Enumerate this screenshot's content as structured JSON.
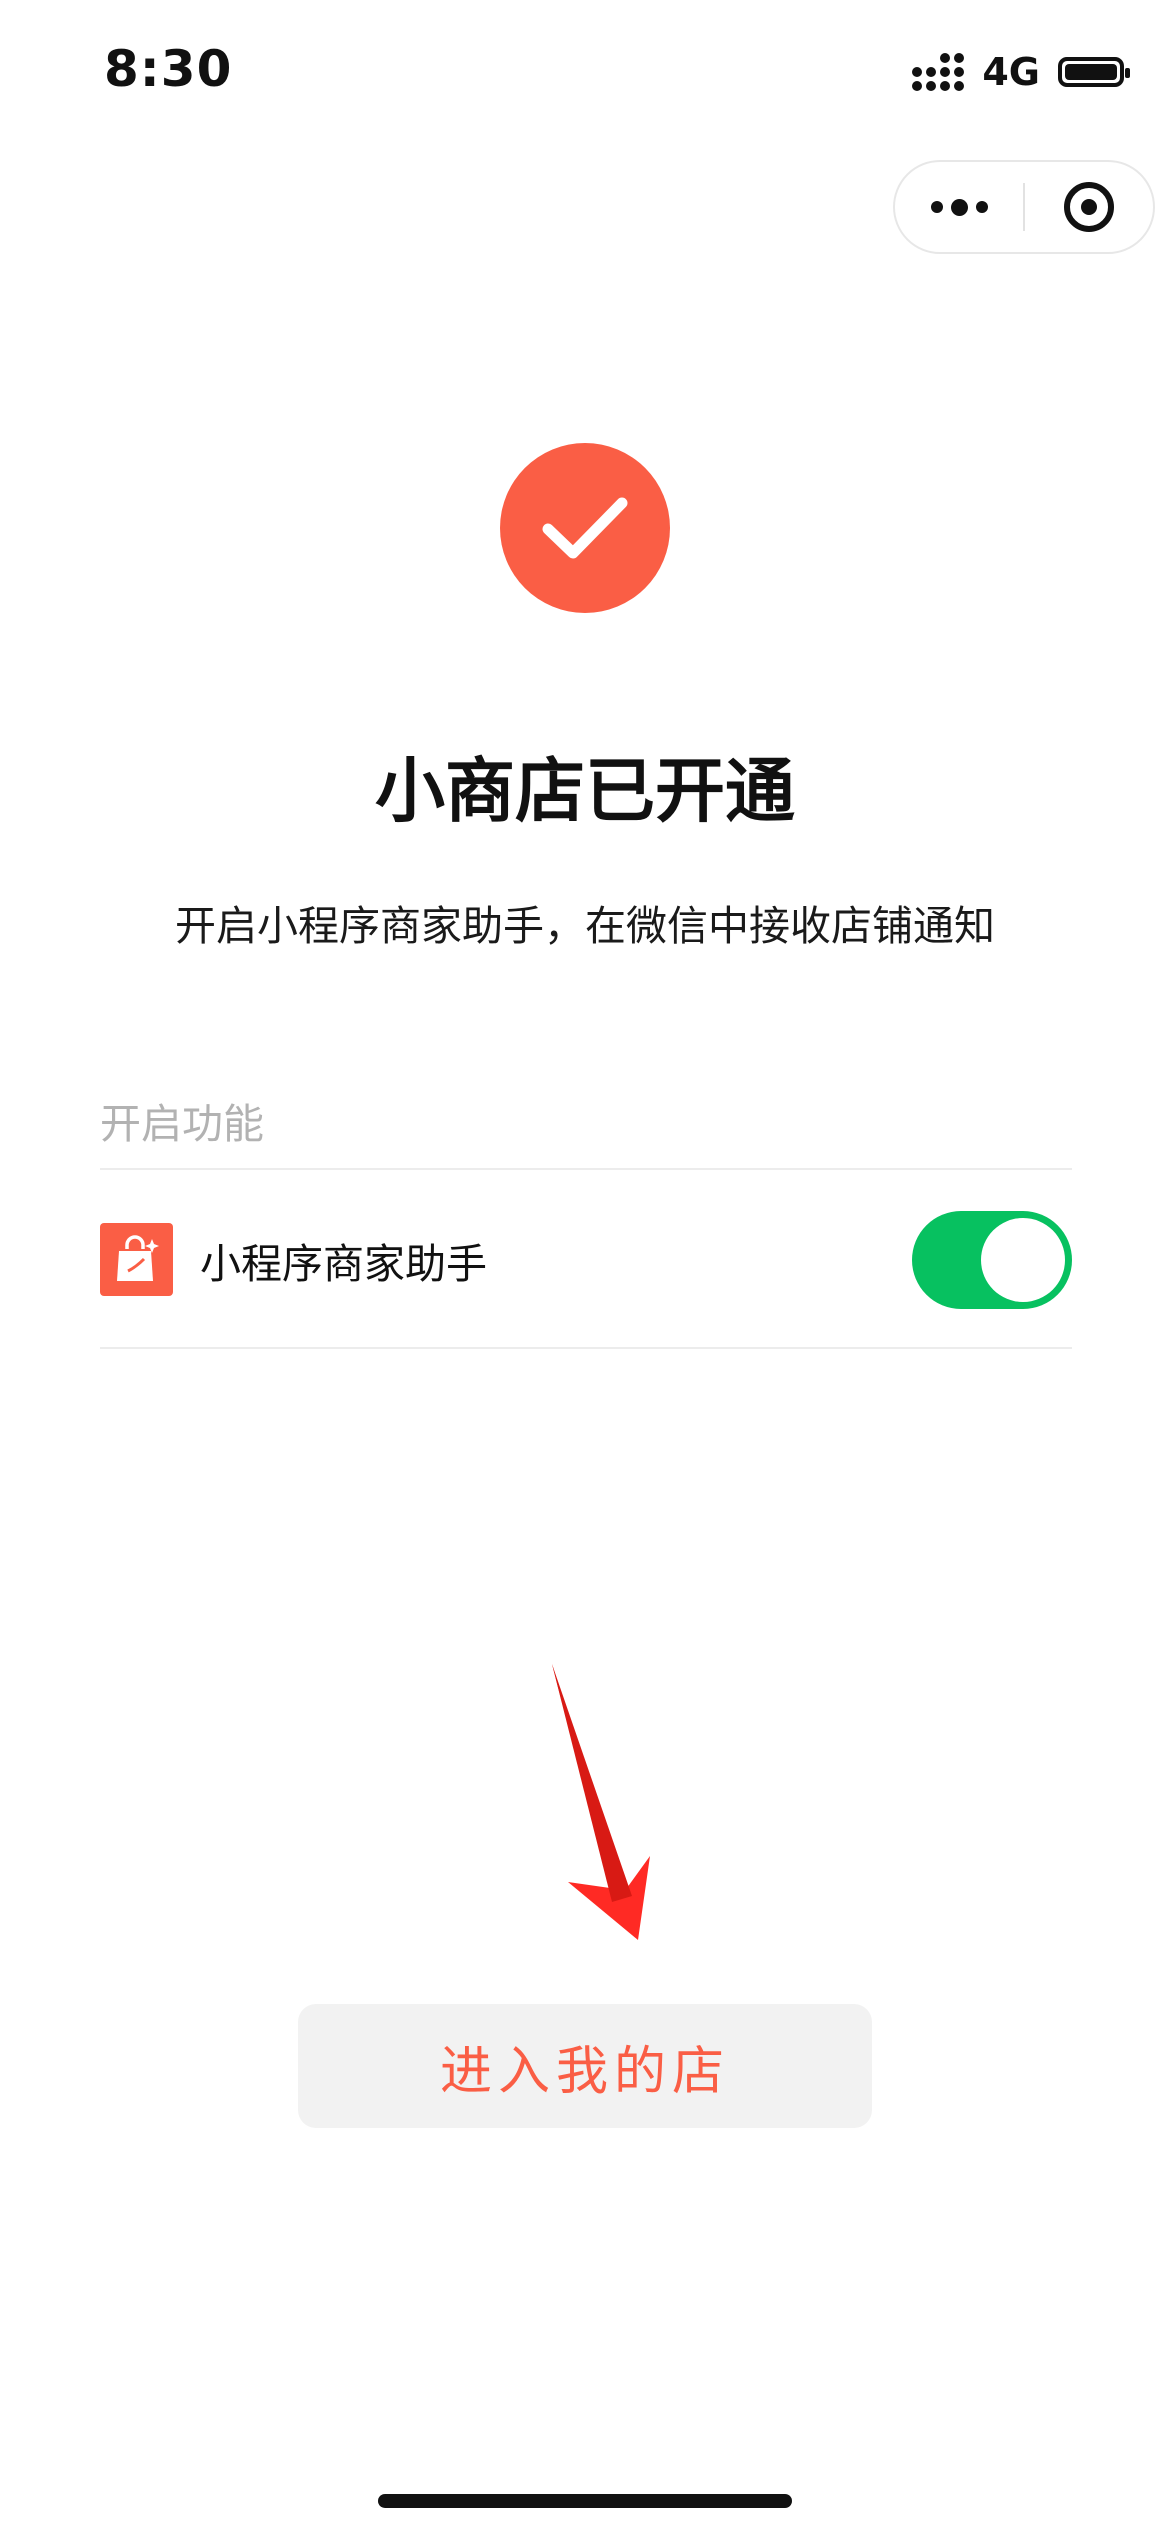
{
  "status_bar": {
    "time": "8:30",
    "network": "4G"
  },
  "capsule": {
    "more_icon": "more-dots-icon",
    "close_icon": "target-circle-icon"
  },
  "result": {
    "icon": "check-icon",
    "title": "小商店已开通",
    "subtitle": "开启小程序商家助手，在微信中接收店铺通知"
  },
  "features": {
    "section_label": "开启功能",
    "items": [
      {
        "label": "小程序商家助手",
        "icon": "shopping-bag-icon",
        "enabled": true
      }
    ]
  },
  "primary_action": {
    "label": "进入我的店"
  },
  "colors": {
    "accent": "#fa5e45",
    "toggle_on": "#07c160",
    "secondary_text": "#b2b2b2",
    "button_bg": "#f2f2f2"
  }
}
